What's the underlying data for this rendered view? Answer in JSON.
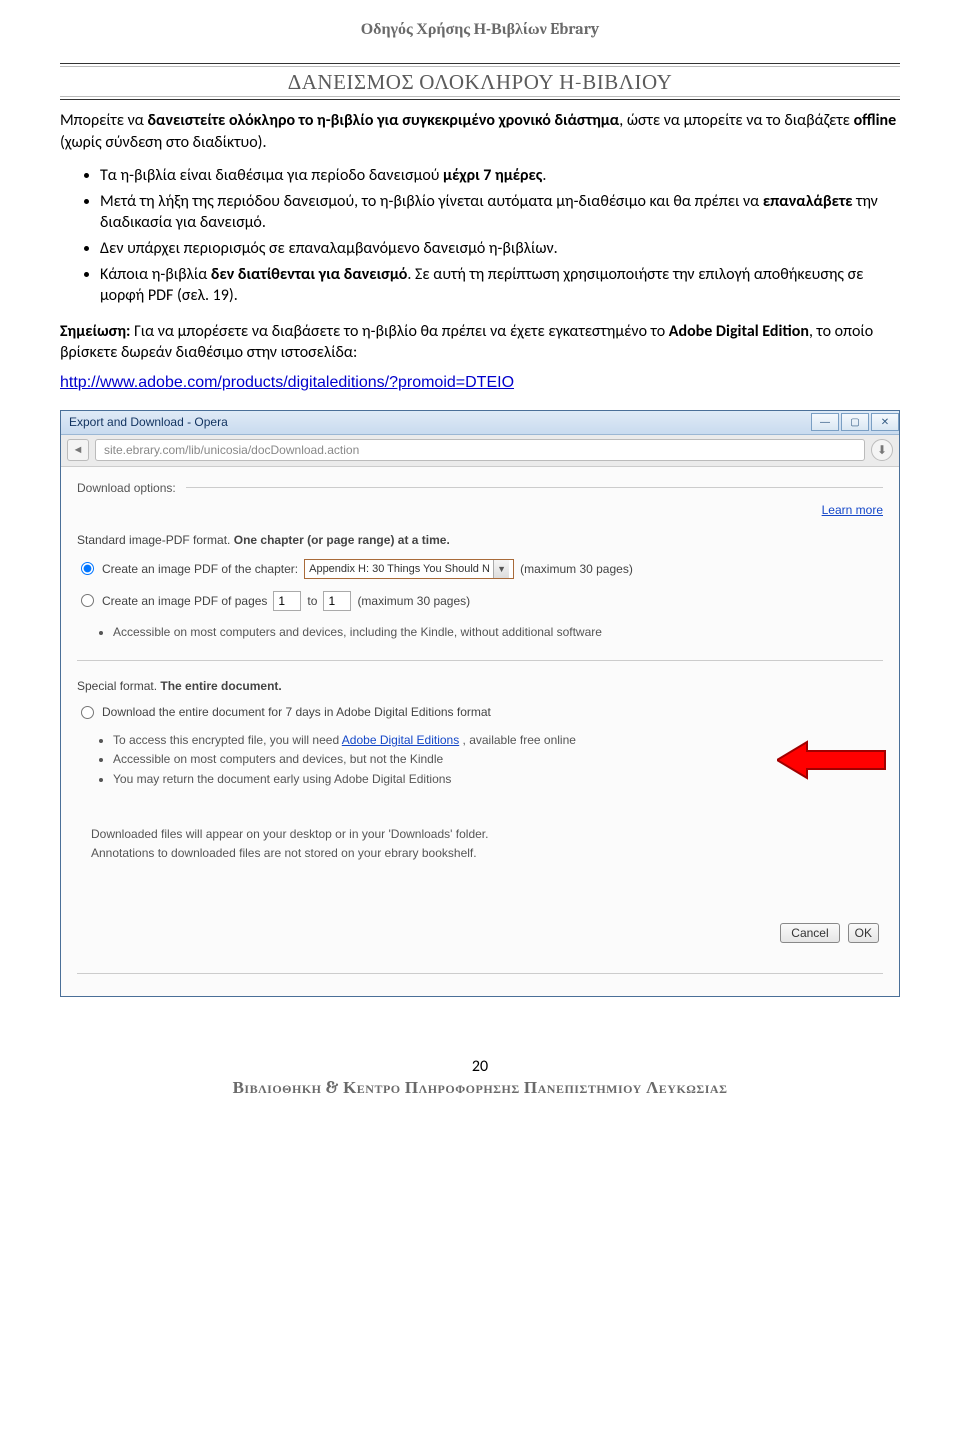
{
  "header": {
    "title": "Οδηγός Χρήσης Η-Βιβλίων Ebrary"
  },
  "section": {
    "title": "ΔΑΝΕΙΣΜΟΣ ΟΛΟΚΛΗΡΟΥ Η-ΒΙΒΛΙΟΥ"
  },
  "intro": {
    "p1a": "Μπορείτε να ",
    "p1b": "δανειστείτε ολόκληρο το η-βιβλίο για συγκεκριμένο χρονικό διάστημα",
    "p1c": ", ώστε να μπορείτε να το διαβάζετε ",
    "p1d": "offline",
    "p1e": " (χωρίς σύνδεση στο διαδίκτυο)."
  },
  "bullets": {
    "b1a": "Τα η-βιβλία είναι διαθέσιμα για περίοδο δανεισμού ",
    "b1b": "μέχρι 7 ημέρες",
    "b1c": ".",
    "b2a": "Μετά τη λήξη της περιόδου δανεισμού, το η-βιβλίο  γίνεται αυτόματα μη-διαθέσιμο και θα πρέπει να ",
    "b2b": "επαναλάβετε",
    "b2c": " την διαδικασία για δανεισμό.",
    "b3": "Δεν υπάρχει περιορισμός σε επαναλαμβανόμενο δανεισμό η-βιβλίων.",
    "b4a": " Κάποια η-βιβλία ",
    "b4b": "δεν διατίθενται για δανεισμό",
    "b4c": ". Σε αυτή τη περίπτωση χρησιμοποιήστε την επιλογή αποθήκευσης σε μορφή PDF (σελ. 19)."
  },
  "note": {
    "a": "Σημείωση:",
    "b": " Για να μπορέσετε να διαβάσετε το η-βιβλίο θα πρέπει να έχετε εγκατεστημένο το ",
    "c": "Adobe Digital Edition",
    "d": ", το οποίο βρίσκετε δωρεάν διαθέσιμο στην ιστοσελίδα:"
  },
  "url": "http://www.adobe.com/products/digitaleditions/?promoid=DTEIO",
  "win": {
    "title": "Export and Download - Opera",
    "min": "—",
    "max": "▢",
    "close": "✕",
    "back": "◄",
    "addr": "site.ebrary.com/lib/unicosia/docDownload.action",
    "dl": "⬇"
  },
  "dialog": {
    "legend": "Download options:",
    "learn_more": "Learn more",
    "std_head_a": "Standard image-PDF format. ",
    "std_head_b": "One chapter (or page range) at a time.",
    "opt1_label": "Create an image PDF of the chapter:",
    "opt1_select": "Appendix H: 30 Things You Should N",
    "opt1_max": "(maximum 30 pages)",
    "opt2_label": "Create an image PDF of pages",
    "opt2_from": "1",
    "opt2_to_lbl": "to",
    "opt2_to": "1",
    "opt2_max": "(maximum 30 pages)",
    "std_sub1": "Accessible on most computers and devices, including the Kindle, without additional software",
    "sp_head_a": "Special format. ",
    "sp_head_b": "The entire document.",
    "opt3_label": "Download the entire document for 7 days in Adobe Digital Editions format",
    "sp_sub1a": "To access this encrypted file, you will need ",
    "sp_sub1_link": "Adobe Digital Editions",
    "sp_sub1b": " , available free online",
    "sp_sub2": "Accessible on most computers and devices, but not the Kindle",
    "sp_sub3": "You may return the document early using Adobe Digital Editions",
    "foot1": "Downloaded files will appear on your desktop or in your 'Downloads' folder.",
    "foot2": "Annotations to downloaded files are not stored on your ebrary bookshelf.",
    "cancel": "Cancel",
    "ok": "OK"
  },
  "page_number": "20",
  "footer": "Βιβλιοθηκη & Κεντρο Πληροφορησης Πανεπιστημιου Λευκωσιας"
}
